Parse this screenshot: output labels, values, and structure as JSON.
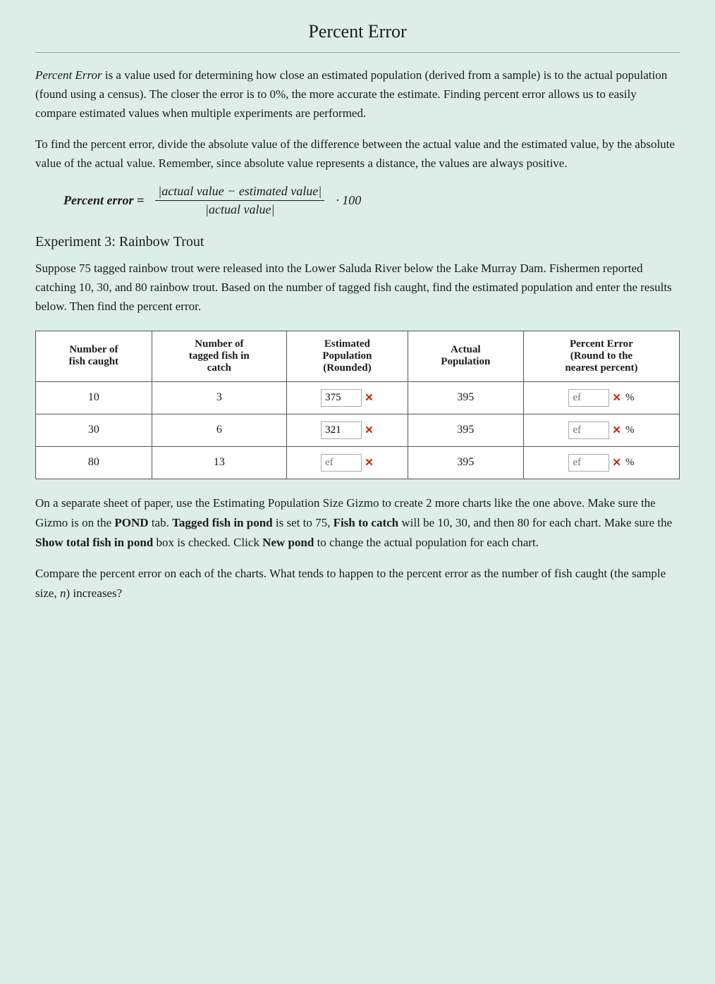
{
  "page": {
    "title": "Percent Error",
    "intro_paragraphs": [
      "Percent Error is a value used for determining how close an estimated population (derived from a sample) is to the actual population (found using a census). The closer the error is to 0%, the more accurate the estimate. Finding percent error allows us to easily compare estimated values when multiple experiments are performed.",
      "To find the percent error, divide the absolute value of the difference between the actual value and the estimated value, by the absolute value of the actual value. Remember, since absolute value represents a distance, the values are always positive."
    ],
    "formula": {
      "lhs": "Percent error =",
      "numerator": "|actual value − estimated value|",
      "denominator": "|actual value|",
      "rhs": "· 100"
    },
    "experiment_heading": "Experiment 3: Rainbow Trout",
    "experiment_description": "Suppose 75 tagged rainbow trout were released into the Lower Saluda River below the Lake Murray Dam. Fishermen reported catching 10, 30, and 80 rainbow trout. Based on the number of tagged fish caught, find the estimated population and enter the results below. Then find the percent error.",
    "table": {
      "headers": [
        "Number of fish caught",
        "Number of tagged fish in catch",
        "Estimated Population (Rounded)",
        "Actual Population",
        "Percent Error (Round to the nearest percent)"
      ],
      "rows": [
        {
          "fish_caught": "10",
          "tagged_in_catch": "3",
          "est_pop_value": "375",
          "actual_pop": "395",
          "pct_err_value": ""
        },
        {
          "fish_caught": "30",
          "tagged_in_catch": "6",
          "est_pop_value": "321",
          "actual_pop": "395",
          "pct_err_value": ""
        },
        {
          "fish_caught": "80",
          "tagged_in_catch": "13",
          "est_pop_value": "",
          "actual_pop": "395",
          "pct_err_value": ""
        }
      ],
      "input_placeholder": "ef",
      "pct_symbol": "%"
    },
    "bottom_paragraphs": [
      "On a separate sheet of paper, use the Estimating Population Size Gizmo to create 2 more charts like the one above. Make sure the Gizmo is on the POND tab. Tagged fish in pond is set to 75, Fish to catch will be 10, 30, and then 80 for each chart. Make sure the Show total fish in pond box is checked. Click New pond to change the actual population for each chart.",
      "Compare the percent error on each of the charts. What tends to happen to the percent error as the number of fish caught (the sample size, n) increases?"
    ],
    "bold_segments": {
      "POND": "POND",
      "Tagged fish in pond": "Tagged fish in pond",
      "Fish to catch": "Fish to catch",
      "Show total fish in pond": "Show total fish in pond",
      "New pond": "New pond"
    }
  }
}
